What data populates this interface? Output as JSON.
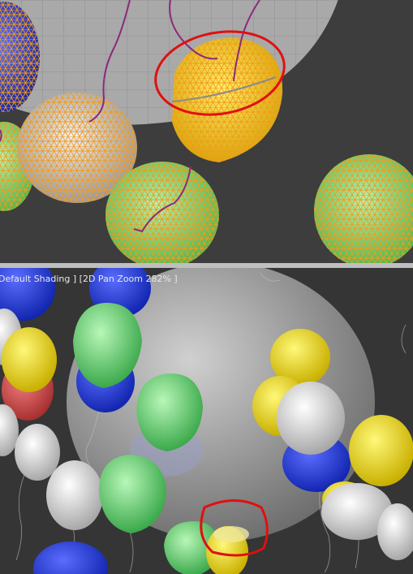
{
  "bottom_viewport": {
    "label_shading": "Default Shading",
    "label_zoom": "2D Pan Zoom 282%"
  },
  "colors": {
    "wire_orange": "#f39a1d",
    "string_purple": "#8a2a7a",
    "highlight_red": "#e01010",
    "balloon_blue": "#2840d8",
    "balloon_white": "#e4e4e4",
    "balloon_yellow": "#f2e020",
    "balloon_green": "#7ee07e",
    "balloon_red": "#d05050"
  },
  "icons": [
    "red-circle-annotation"
  ]
}
